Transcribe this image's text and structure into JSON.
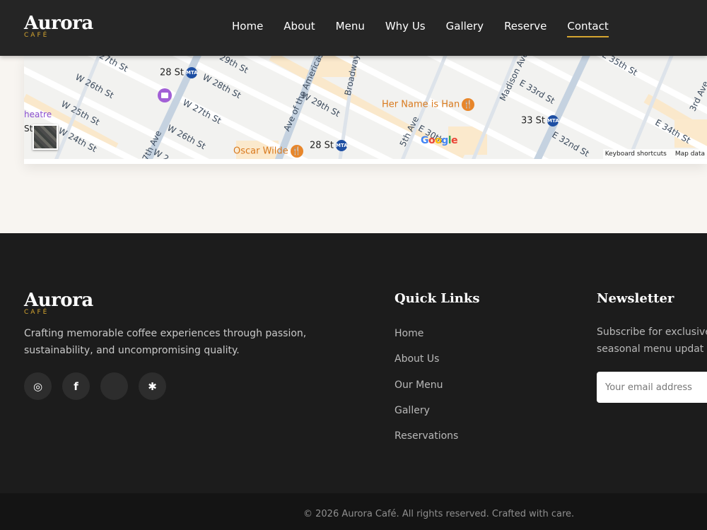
{
  "brand": {
    "name": "Aurora",
    "sub": "CAFÉ"
  },
  "nav": {
    "items": [
      {
        "label": "Home"
      },
      {
        "label": "About"
      },
      {
        "label": "Menu"
      },
      {
        "label": "Why Us"
      },
      {
        "label": "Gallery"
      },
      {
        "label": "Reserve"
      },
      {
        "label": "Contact"
      }
    ],
    "active": "Contact"
  },
  "map": {
    "streets": [
      "27th St",
      "W 26th St",
      "W 25th St",
      "W 24th St",
      "W 28th St",
      "W 27th St",
      "W 26th St",
      "29th St",
      "W 29th St",
      "Ave of the Americas",
      "Broadway",
      "Madison Ave",
      "E 33rd St",
      "E 32nd St",
      "E 35th St",
      "E 34th St",
      "3rd Ave",
      "5th Ave",
      "7th Ave",
      "E 30th",
      "W 2"
    ],
    "stations": [
      "28 St",
      "28 St",
      "33 St"
    ],
    "places": [
      "Her Name is Han",
      "Oscar Wilde",
      "heatre",
      "St"
    ],
    "provider": "Google",
    "footer": [
      "Keyboard shortcuts",
      "Map data"
    ]
  },
  "footer": {
    "description": "Crafting memorable coffee experiences through passion, sustainability, and uncompromising quality.",
    "socials": [
      {
        "icon": "instagram-icon",
        "glyph": "◎"
      },
      {
        "icon": "facebook-icon",
        "glyph": "f"
      },
      {
        "icon": "twitter-icon",
        "glyph": ""
      },
      {
        "icon": "yelp-icon",
        "glyph": "✱"
      }
    ],
    "quick_links": {
      "title": "Quick Links",
      "items": [
        "Home",
        "About Us",
        "Our Menu",
        "Gallery",
        "Reservations"
      ]
    },
    "newsletter": {
      "title": "Newsletter",
      "text": [
        "Subscribe for exclusive",
        "seasonal menu updat"
      ],
      "placeholder": "Your email address"
    },
    "copyright": "© 2026 Aurora Café. All rights reserved. Crafted with care."
  },
  "colors": {
    "accent": "#d4a530",
    "footer_bg": "#1c1c1c",
    "header_bg": "#252525"
  }
}
